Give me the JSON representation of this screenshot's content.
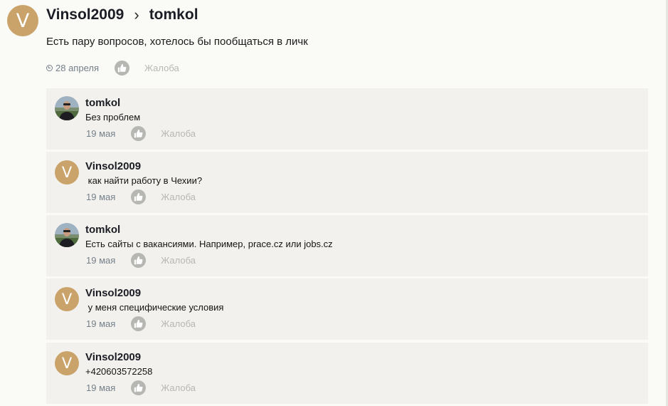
{
  "post": {
    "author_initial": "V",
    "author": "Vinsol2009",
    "separator": "›",
    "recipient": "tomkol",
    "text": "Есть пару вопросов, хотелось бы пообщаться в личк",
    "date": "28 апреля",
    "complain_label": "Жалоба"
  },
  "comments": [
    {
      "author": "tomkol",
      "avatar": "photo",
      "text": "Без проблем",
      "date": "19 мая",
      "complain_label": "Жалоба"
    },
    {
      "author": "Vinsol2009",
      "avatar_initial": "V",
      "text": " как найти работу в Чехии?",
      "date": "19 мая",
      "complain_label": "Жалоба"
    },
    {
      "author": "tomkol",
      "avatar": "photo",
      "text": "Есть сайты с вакансиями. Например, prace.cz или jobs.cz",
      "date": "19 мая",
      "complain_label": "Жалоба"
    },
    {
      "author": "Vinsol2009",
      "avatar_initial": "V",
      "text": " у меня специфические условия",
      "date": "19 мая",
      "complain_label": "Жалоба"
    },
    {
      "author": "Vinsol2009",
      "avatar_initial": "V",
      "text": "+420603572258",
      "date": "19 мая",
      "complain_label": "Жалоба"
    }
  ],
  "colors": {
    "avatar_bg": "#c9a36a",
    "comment_bg": "#f2f1ed",
    "date_text": "#74808a",
    "complain_text": "#b7b7b2",
    "like_button": "#b6b6b2"
  },
  "icons": {
    "clock": "clock-icon",
    "like": "thumbs-up-icon"
  }
}
